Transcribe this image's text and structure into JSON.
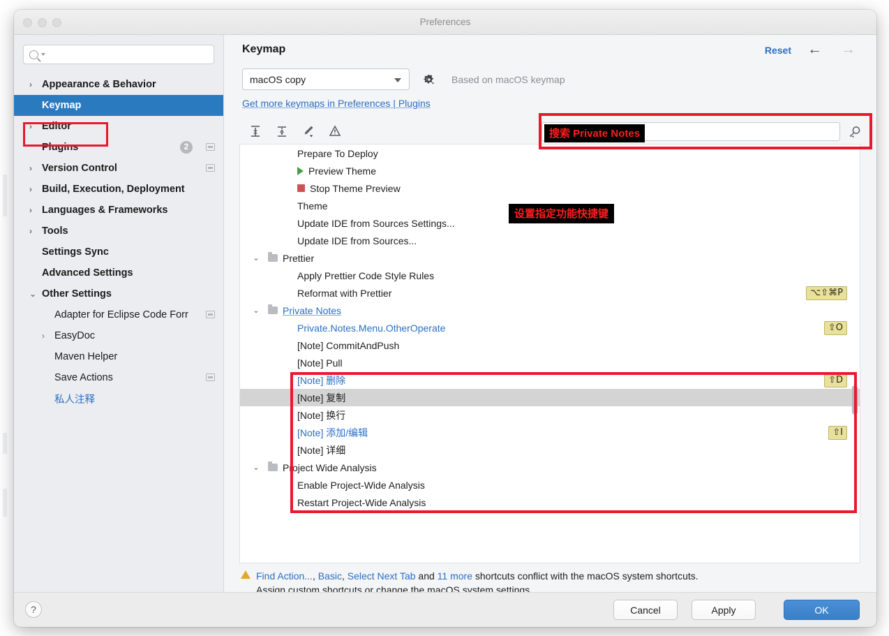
{
  "window": {
    "title": "Preferences",
    "traffic_lights": [
      "close",
      "minimize",
      "maximize"
    ]
  },
  "sidebar": {
    "search_placeholder": "",
    "items": [
      {
        "label": "Appearance & Behavior",
        "level": 0,
        "arrow": "›",
        "bold": true
      },
      {
        "label": "Keymap",
        "level": 0,
        "arrow": "",
        "bold": true,
        "selected": true
      },
      {
        "label": "Editor",
        "level": 0,
        "arrow": "›",
        "bold": true
      },
      {
        "label": "Plugins",
        "level": 0,
        "arrow": "",
        "bold": true,
        "badge": "2",
        "winicon": true
      },
      {
        "label": "Version Control",
        "level": 0,
        "arrow": "›",
        "bold": true,
        "winicon": true
      },
      {
        "label": "Build, Execution, Deployment",
        "level": 0,
        "arrow": "›",
        "bold": true
      },
      {
        "label": "Languages & Frameworks",
        "level": 0,
        "arrow": "›",
        "bold": true
      },
      {
        "label": "Tools",
        "level": 0,
        "arrow": "›",
        "bold": true
      },
      {
        "label": "Settings Sync",
        "level": 0,
        "arrow": "",
        "bold": true
      },
      {
        "label": "Advanced Settings",
        "level": 0,
        "arrow": "",
        "bold": true
      },
      {
        "label": "Other Settings",
        "level": 0,
        "arrow": "⌄",
        "bold": true,
        "expanded": true
      },
      {
        "label": "Adapter for Eclipse Code Forr",
        "level": 1,
        "arrow": "",
        "winicon": true
      },
      {
        "label": "EasyDoc",
        "level": 1,
        "arrow": "›"
      },
      {
        "label": "Maven Helper",
        "level": 1,
        "arrow": ""
      },
      {
        "label": "Save Actions",
        "level": 1,
        "arrow": "",
        "winicon": true
      },
      {
        "label": "私人注释",
        "level": 1,
        "arrow": "",
        "blue": true
      }
    ]
  },
  "main": {
    "page_title": "Keymap",
    "reset_label": "Reset",
    "back_icon": "←",
    "forward_icon": "→",
    "keymap_select_value": "macOS copy",
    "based_on": "Based on macOS keymap",
    "get_more_link": "Get more keymaps in Preferences | Plugins",
    "toolbar_icons": [
      "expand-all-icon",
      "collapse-all-icon",
      "edit-shortcut-icon",
      "show-conflicts-icon"
    ],
    "tree_search_placeholder": "",
    "search_tooltip": "搜索 Private Notes",
    "notes_tooltip": "设置指定功能快捷键"
  },
  "tree": [
    {
      "label": "Prepare To Deploy",
      "indent": 104,
      "icon": "none"
    },
    {
      "label": "Preview Theme",
      "indent": 104,
      "icon": "run"
    },
    {
      "label": "Stop Theme Preview",
      "indent": 104,
      "icon": "stop"
    },
    {
      "label": "Theme",
      "indent": 104,
      "icon": "none"
    },
    {
      "label": "Update IDE from Sources Settings...",
      "indent": 104,
      "icon": "none"
    },
    {
      "label": "Update IDE from Sources...",
      "indent": 104,
      "icon": "none"
    },
    {
      "label": "Prettier",
      "indent": 62,
      "icon": "folder",
      "twisty": "⌄"
    },
    {
      "label": "Apply Prettier Code Style Rules",
      "indent": 104,
      "icon": "none"
    },
    {
      "label": "Reformat with Prettier",
      "indent": 104,
      "icon": "none",
      "shortcut": "⌥⇧⌘P"
    },
    {
      "label": "Private Notes",
      "indent": 62,
      "icon": "folder",
      "twisty": "⌄",
      "blue": true,
      "underline": true
    },
    {
      "label": "Private.Notes.Menu.OtherOperate",
      "indent": 104,
      "icon": "none",
      "blue": true,
      "shortcut": "⇧O"
    },
    {
      "label": "[Note] CommitAndPush",
      "indent": 104,
      "icon": "none"
    },
    {
      "label": "[Note] Pull",
      "indent": 104,
      "icon": "none"
    },
    {
      "label": "[Note] 删除",
      "indent": 104,
      "icon": "none",
      "blue": true,
      "shortcut": "⇧D"
    },
    {
      "label": "[Note] 复制",
      "indent": 104,
      "icon": "none",
      "selected": true
    },
    {
      "label": "[Note] 换行",
      "indent": 104,
      "icon": "none"
    },
    {
      "label": "[Note] 添加/编辑",
      "indent": 104,
      "icon": "none",
      "blue": true,
      "shortcut": "⇧I"
    },
    {
      "label": "[Note] 详细",
      "indent": 104,
      "icon": "none"
    },
    {
      "label": "Project Wide Analysis",
      "indent": 62,
      "icon": "folder",
      "twisty": "⌄"
    },
    {
      "label": "Enable Project-Wide Analysis",
      "indent": 104,
      "icon": "none"
    },
    {
      "label": "Restart Project-Wide Analysis",
      "indent": 104,
      "icon": "none"
    }
  ],
  "conflict": {
    "link1": "Find Action...",
    "sep1": ", ",
    "link2": "Basic",
    "sep2": ", ",
    "link3": "Select Next Tab",
    "mid": " and ",
    "link4": "11 more",
    "tail": " shortcuts conflict with the macOS system shortcuts.",
    "line2": "Assign custom shortcuts or change the macOS system settings."
  },
  "footer": {
    "help_label": "?",
    "cancel_label": "Cancel",
    "apply_label": "Apply",
    "ok_label": "OK"
  },
  "colors": {
    "selection_blue": "#2a7ac0",
    "link_blue": "#2a6fc4",
    "annotation_red": "#e8192c",
    "tooltip_text_red": "#ff1e1e",
    "shortcut_badge": "#e9e09a",
    "row_selected_gray": "#d4d4d4",
    "ok_button_blue": "#4a90d9"
  }
}
